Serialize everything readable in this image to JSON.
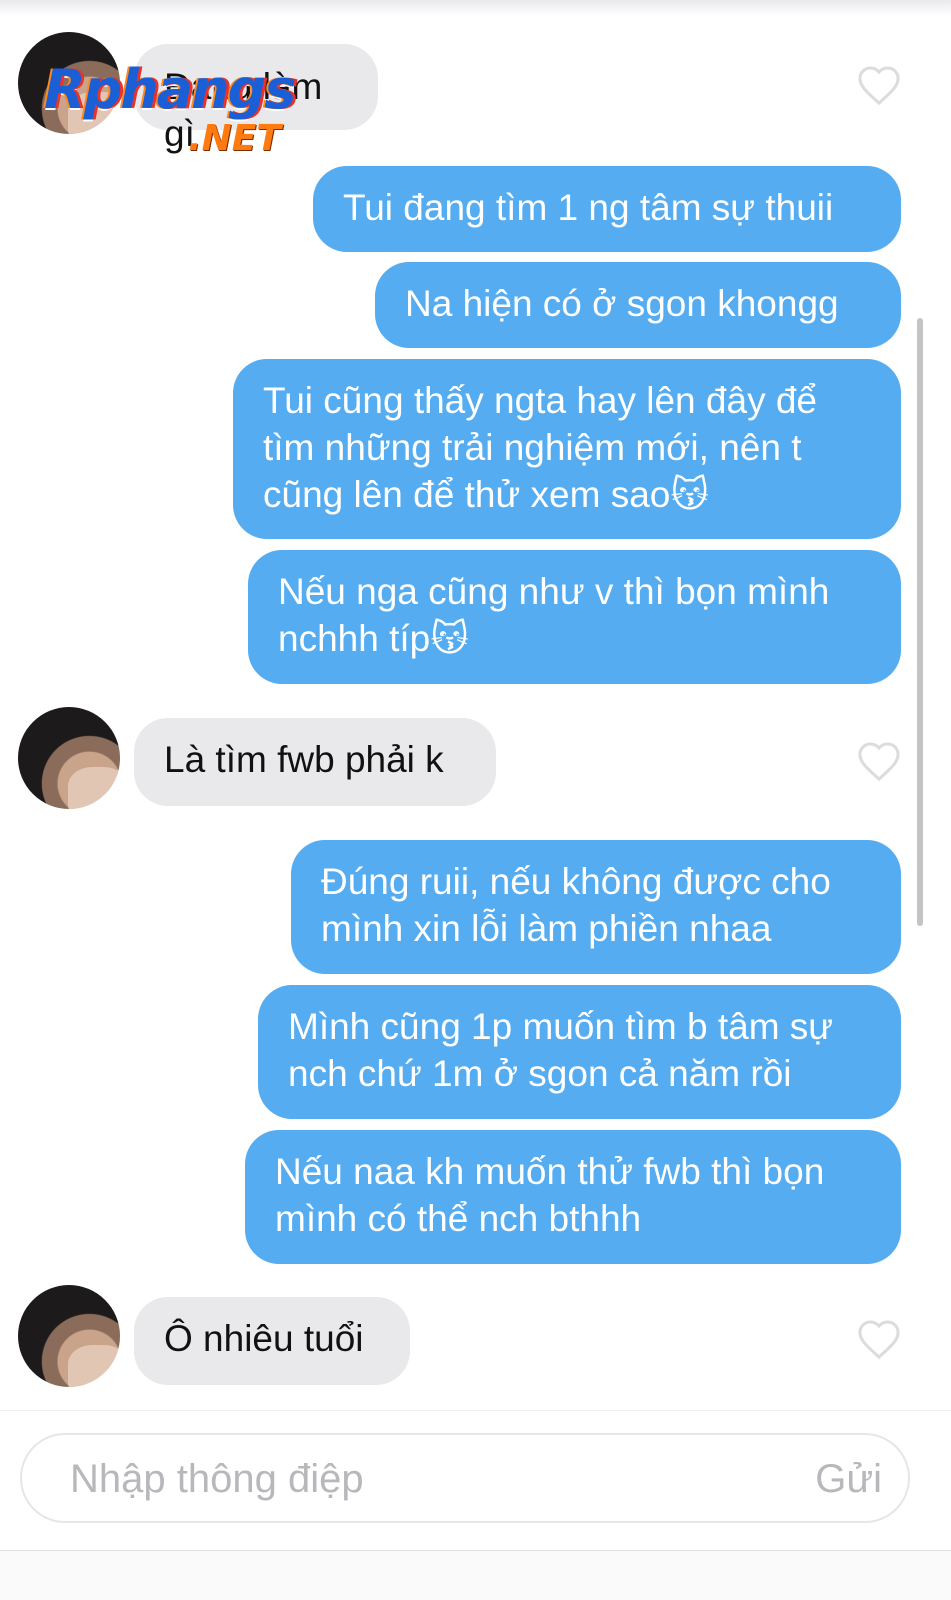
{
  "messages": [
    {
      "side": "in",
      "text": "Đang làm gì"
    },
    {
      "side": "out",
      "text": "Tui đang tìm 1 ng tâm sự thuii"
    },
    {
      "side": "out",
      "text": "Na hiện có ở sgon khongg"
    },
    {
      "side": "out",
      "text": "Tui cũng thấy ngta hay lên đây để\ntìm những trải nghiệm mới, nên t\ncũng lên để thử xem sao😽"
    },
    {
      "side": "out",
      "text": "Nếu nga cũng như v thì bọn mình\nnchhh típ😽"
    },
    {
      "side": "in",
      "text": "Là tìm fwb phải k"
    },
    {
      "side": "out",
      "text": "Đúng ruii, nếu không được cho\nmình xin lỗi làm phiền nhaa"
    },
    {
      "side": "out",
      "text": "Mình cũng 1p muốn tìm b tâm sự\nnch chứ 1m ở sgon cả năm rồi"
    },
    {
      "side": "out",
      "text": "Nếu naa kh muốn thử fwb thì bọn\nmình có thể nch bthhh"
    },
    {
      "side": "in",
      "text": "Ô nhiêu tuổi"
    }
  ],
  "watermark": {
    "main": "Rphangs",
    "suffix": ".NET"
  },
  "composer": {
    "placeholder": "Nhập thông điệp",
    "send_label": "Gửi"
  },
  "colors": {
    "outgoing": "#55acf0",
    "incoming": "#e9e9eb",
    "heart": "#dcdcde"
  },
  "icons": {
    "like": "heart-outline-icon"
  }
}
